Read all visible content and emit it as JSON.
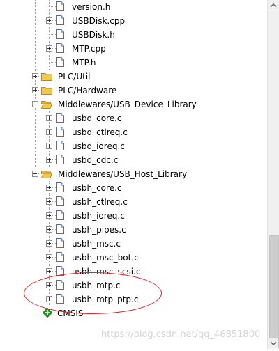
{
  "tree": {
    "items": [
      {
        "label": "version.h",
        "kind": "file",
        "expander": "none",
        "gear": false,
        "level": 3
      },
      {
        "label": "USBDisk.cpp",
        "kind": "file",
        "expander": "plus",
        "gear": false,
        "level": 3
      },
      {
        "label": "USBDisk.h",
        "kind": "file",
        "expander": "none",
        "gear": false,
        "level": 3
      },
      {
        "label": "MTP.cpp",
        "kind": "file",
        "expander": "plus",
        "gear": true,
        "level": 3
      },
      {
        "label": "MTP.h",
        "kind": "file",
        "expander": "none",
        "gear": false,
        "level": 3
      },
      {
        "label": "PLC/Util",
        "kind": "folder",
        "expander": "plus",
        "gear": false,
        "level": 2
      },
      {
        "label": "PLC/Hardware",
        "kind": "folder",
        "expander": "plus",
        "gear": false,
        "level": 2
      },
      {
        "label": "Middlewares/USB_Device_Library",
        "kind": "folder-open",
        "expander": "minus",
        "gear": false,
        "level": 2
      },
      {
        "label": "usbd_core.c",
        "kind": "file",
        "expander": "plus",
        "gear": false,
        "level": 3
      },
      {
        "label": "usbd_ctlreq.c",
        "kind": "file",
        "expander": "plus",
        "gear": false,
        "level": 3
      },
      {
        "label": "usbd_ioreq.c",
        "kind": "file",
        "expander": "plus",
        "gear": false,
        "level": 3
      },
      {
        "label": "usbd_cdc.c",
        "kind": "file",
        "expander": "plus",
        "gear": false,
        "level": 3
      },
      {
        "label": "Middlewares/USB_Host_Library",
        "kind": "folder-open",
        "expander": "minus",
        "gear": false,
        "level": 2
      },
      {
        "label": "usbh_core.c",
        "kind": "file",
        "expander": "plus",
        "gear": true,
        "level": 3
      },
      {
        "label": "usbh_ctlreq.c",
        "kind": "file",
        "expander": "plus",
        "gear": false,
        "level": 3
      },
      {
        "label": "usbh_ioreq.c",
        "kind": "file",
        "expander": "plus",
        "gear": false,
        "level": 3
      },
      {
        "label": "usbh_pipes.c",
        "kind": "file",
        "expander": "plus",
        "gear": false,
        "level": 3
      },
      {
        "label": "usbh_msc.c",
        "kind": "file",
        "expander": "plus",
        "gear": true,
        "level": 3
      },
      {
        "label": "usbh_msc_bot.c",
        "kind": "file",
        "expander": "plus",
        "gear": false,
        "level": 3
      },
      {
        "label": "usbh_msc_scsi.c",
        "kind": "file",
        "expander": "plus",
        "gear": false,
        "level": 3
      },
      {
        "label": "usbh_mtp.c",
        "kind": "file",
        "expander": "plus",
        "gear": true,
        "level": 3
      },
      {
        "label": "usbh_mtp_ptp.c",
        "kind": "file",
        "expander": "plus",
        "gear": true,
        "level": 3
      },
      {
        "label": "CMSIS",
        "kind": "cmsis",
        "expander": "none",
        "gear": false,
        "level": 2
      }
    ]
  },
  "watermark": "https://blog.csdn.net/qq_46851800",
  "colors": {
    "highlight_ellipse": "#e02020",
    "cmsis_icon": "#1fa51f",
    "folder": "#f2c94c",
    "tree_lines": "#a0a0a0"
  }
}
